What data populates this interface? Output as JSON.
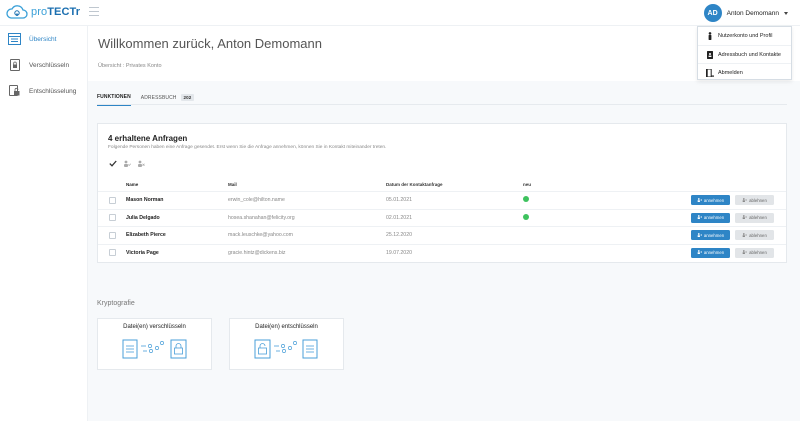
{
  "app": {
    "logo_prefix": "pro",
    "logo_brand": "TECTr"
  },
  "user": {
    "initials": "AD",
    "name": "Anton Demomann"
  },
  "user_menu": {
    "items": [
      {
        "label": "Nutzerkonto und Profil",
        "icon": "person-icon"
      },
      {
        "label": "Adressbuch und Kontakte",
        "icon": "address-book-icon"
      },
      {
        "label": "Abmelden",
        "icon": "logout-icon"
      }
    ]
  },
  "sidebar": {
    "items": [
      {
        "label": "Übersicht",
        "icon": "overview-icon",
        "active": true
      },
      {
        "label": "Verschlüsseln",
        "icon": "lock-icon",
        "active": false
      },
      {
        "label": "Entschlüsselung",
        "icon": "unlock-document-icon",
        "active": false
      }
    ]
  },
  "header": {
    "title": "Willkommen zurück, Anton Demomann",
    "breadcrumb": "Übersicht : Privates Konto"
  },
  "tabs": [
    {
      "label": "FUNKTIONEN",
      "active": true
    },
    {
      "label": "ADRESSBUCH",
      "badge": "202",
      "active": false
    }
  ],
  "requests": {
    "title": "4 erhaltene Anfragen",
    "subtitle": "Folgende Personen haben eine Anfrage gesendet. Erst wenn Sie die Anfrage annehmen, können Sie in Kontakt miteinander treten.",
    "columns": {
      "name": "Name",
      "mail": "Mail",
      "date": "Datum der Kontaktanfrage",
      "new": "neu"
    },
    "accept_label": "annehmen",
    "decline_label": "ablehnen",
    "rows": [
      {
        "name": "Mason Norman",
        "mail": "erwin_cole@hilton.name",
        "date": "05.01.2021",
        "new": true
      },
      {
        "name": "Julia Delgado",
        "mail": "hosea.shanahan@felicity.org",
        "date": "02.01.2021",
        "new": true
      },
      {
        "name": "Elizabeth Pierce",
        "mail": "mack.leuschke@yahoo.com",
        "date": "25.12.2020",
        "new": false
      },
      {
        "name": "Victoria Page",
        "mail": "gracie.hintz@dickens.biz",
        "date": "19.07.2020",
        "new": false
      }
    ]
  },
  "crypto": {
    "title": "Kryptografie",
    "cards": [
      {
        "label": "Datei(en) verschlüsseln"
      },
      {
        "label": "Datei(en) entschlüsseln"
      }
    ]
  },
  "colors": {
    "accent": "#2e85c6",
    "new_dot": "#3ec25e",
    "decline_bg": "#e2e5e8"
  }
}
